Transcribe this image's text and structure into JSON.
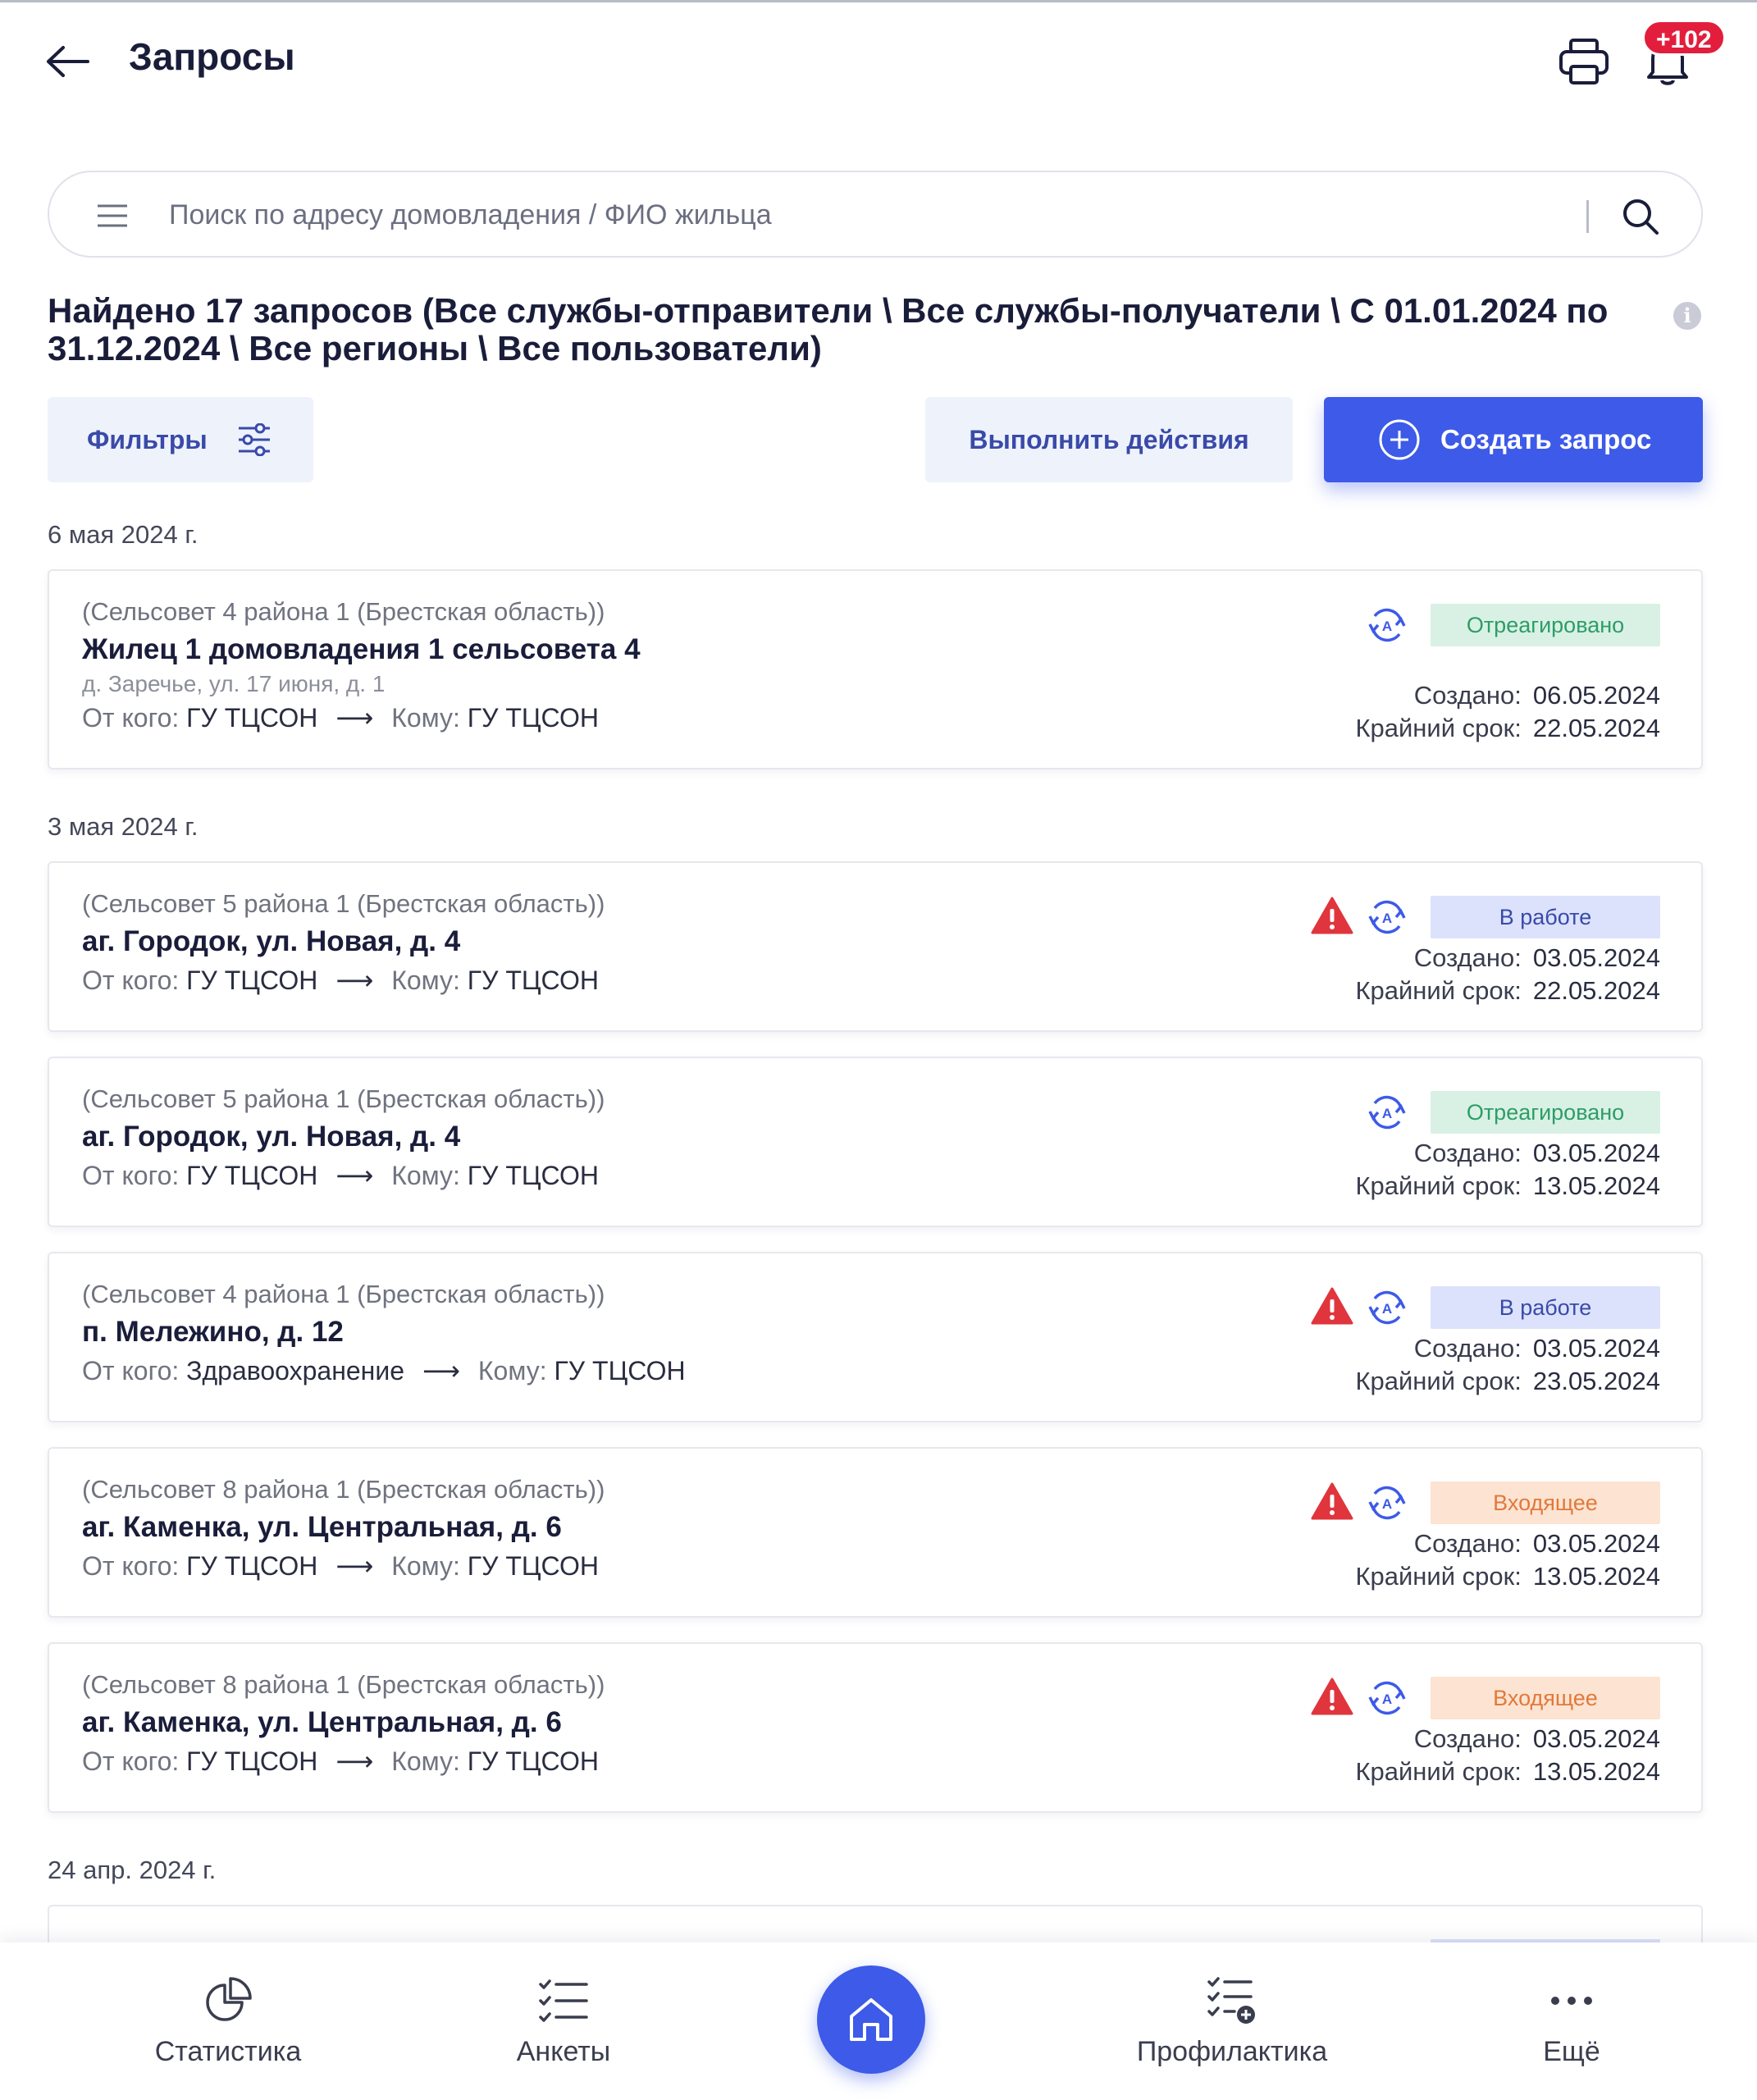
{
  "header": {
    "title": "Запросы",
    "notifications_badge": "+102"
  },
  "search": {
    "placeholder": "Поиск по адресу домовладения / ФИО жильца",
    "value": ""
  },
  "summary": {
    "text": "Найдено 17 запросов (Все службы-отправители \\ Все службы-получатели \\ С 01.01.2024 по 31.12.2024 \\ Все регионы \\ Все пользователи)"
  },
  "actions": {
    "filters_label": "Фильтры",
    "execute_label": "Выполнить действия",
    "create_label": "Создать запрос"
  },
  "labels": {
    "from": "От кого:",
    "to": "Кому:",
    "created": "Создано:",
    "deadline": "Крайний срок:"
  },
  "groups": [
    {
      "date": "6 мая 2024 г."
    },
    {
      "date": "3 мая 2024 г."
    },
    {
      "date": "24 апр. 2024 г."
    }
  ],
  "requests": [
    {
      "org": "(Сельсовет 4 района 1 (Брестская область))",
      "title": "Жилец 1 домовладения 1 сельсовета 4",
      "address": "д. Заречье, ул. 17 июня, д. 1",
      "from": "ГУ ТЦСОН",
      "to": "ГУ ТЦСОН",
      "status": "Отреагировано",
      "status_color": "#2e9d67",
      "warning": false,
      "created": "06.05.2024",
      "deadline": "22.05.2024"
    },
    {
      "org": "(Сельсовет 5 района 1 (Брестская область))",
      "title": "аг. Городок, ул. Новая, д. 4",
      "from": "ГУ ТЦСОН",
      "to": "ГУ ТЦСОН",
      "status": "В работе",
      "status_color": "#3a4aa8",
      "warning": true,
      "created": "03.05.2024",
      "deadline": "22.05.2024"
    },
    {
      "org": "(Сельсовет 5 района 1 (Брестская область))",
      "title": "аг. Городок, ул. Новая, д. 4",
      "from": "ГУ ТЦСОН",
      "to": "ГУ ТЦСОН",
      "status": "Отреагировано",
      "status_color": "#2e9d67",
      "warning": false,
      "created": "03.05.2024",
      "deadline": "13.05.2024"
    },
    {
      "org": "(Сельсовет 4 района 1 (Брестская область))",
      "title": "п. Мележино, д. 12",
      "from": "Здравоохранение",
      "to": "ГУ ТЦСОН",
      "status": "В работе",
      "status_color": "#3a4aa8",
      "warning": true,
      "created": "03.05.2024",
      "deadline": "23.05.2024"
    },
    {
      "org": "(Сельсовет 8 района 1 (Брестская область))",
      "title": "аг. Каменка, ул. Центральная, д. 6",
      "from": "ГУ ТЦСОН",
      "to": "ГУ ТЦСОН",
      "status": "Входящее",
      "status_color": "#e07a3a",
      "warning": true,
      "created": "03.05.2024",
      "deadline": "13.05.2024"
    },
    {
      "org": "(Сельсовет 8 района 1 (Брестская область))",
      "title": "аг. Каменка, ул. Центральная, д. 6",
      "from": "ГУ ТЦСОН",
      "to": "ГУ ТЦСОН",
      "status": "Входящее",
      "status_color": "#e07a3a",
      "warning": true,
      "created": "03.05.2024",
      "deadline": "13.05.2024"
    }
  ],
  "bottom_nav": [
    {
      "label": "Статистика",
      "icon": "pie-chart-icon"
    },
    {
      "label": "Анкеты",
      "icon": "checklist-icon"
    },
    {
      "label": "",
      "icon": "home-icon"
    },
    {
      "label": "Профилактика",
      "icon": "checklist-add-icon"
    },
    {
      "label": "Ещё",
      "icon": "more-icon"
    }
  ],
  "colors": {
    "accent": "#3d5ae8",
    "badge": "#e21e3c",
    "warning": "#e0353d"
  }
}
